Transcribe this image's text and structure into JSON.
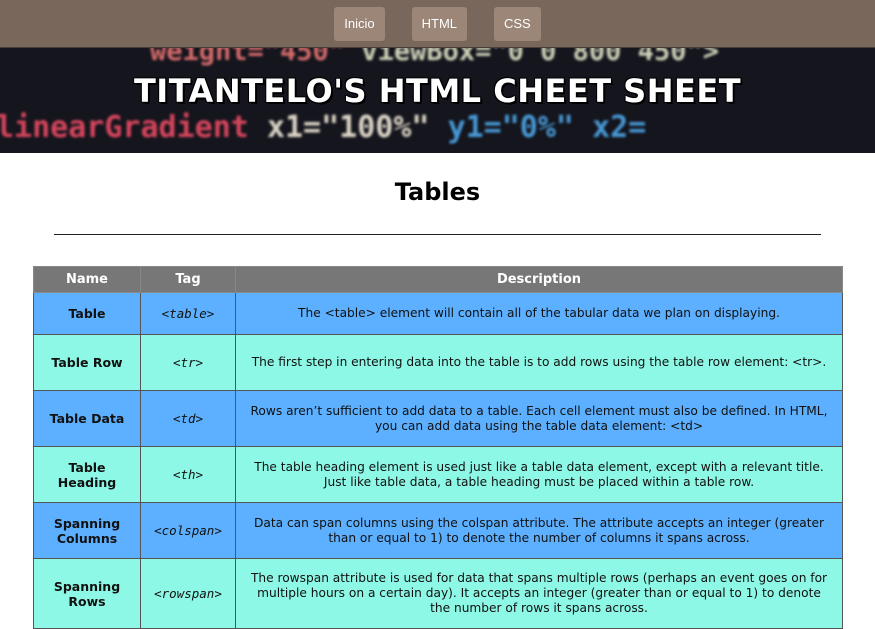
{
  "nav": {
    "items": [
      {
        "label": "Inicio"
      },
      {
        "label": "HTML"
      },
      {
        "label": "CSS"
      }
    ]
  },
  "banner": {
    "title": "TITANTELO'S HTML CHEET SHEET",
    "code_fragments": [
      "weight=\"450\"",
      "viewBox=\"0 0 800 450\">",
      "linearGradient",
      "x1=\"100%\"",
      "y1=\"0%\"",
      "x2="
    ]
  },
  "section": {
    "title": "Tables"
  },
  "table": {
    "headers": {
      "name": "Name",
      "tag": "Tag",
      "description": "Description"
    },
    "rows": [
      {
        "name": "Table",
        "tag": "<table>",
        "description": "The <table> element will contain all of the tabular data we plan on displaying."
      },
      {
        "name": "Table Row",
        "tag": "<tr>",
        "description": "The first step in entering data into the table is to add rows using the table row element: <tr>."
      },
      {
        "name": "Table Data",
        "tag": "<td>",
        "description": "Rows aren’t sufficient to add data to a table. Each cell element must also be defined. In HTML, you can add data using the table data element: <td>"
      },
      {
        "name": "Table Heading",
        "tag": "<th>",
        "description": "The table heading element is used just like a table data element, except with a relevant title. Just like table data, a table heading must be placed within a table row."
      },
      {
        "name": "Spanning Columns",
        "tag": "<colspan>",
        "description": "Data can span columns using the colspan attribute. The attribute accepts an integer (greater than or equal to 1) to denote the number of columns it spans across."
      },
      {
        "name": "Spanning Rows",
        "tag": "<rowspan>",
        "description": "The rowspan attribute is used for data that spans multiple rows (perhaps an event goes on for multiple hours on a certain day). It accepts an integer (greater than or equal to 1) to denote the number of rows it spans across."
      }
    ]
  },
  "colors": {
    "nav_bg": "#7a675c",
    "nav_button": "#9b8677",
    "header_row": "#777777",
    "row_blue": "#5cb0ff",
    "row_mint": "#8ef8e6"
  }
}
